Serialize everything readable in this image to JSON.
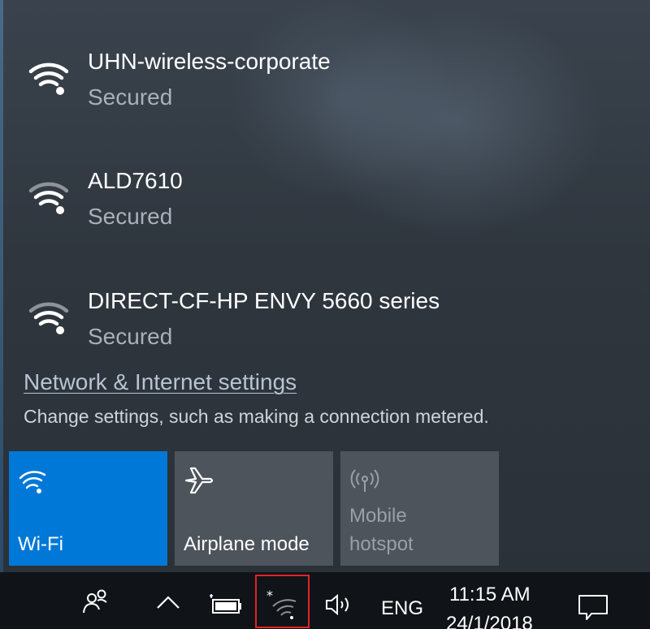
{
  "networks": [
    {
      "name": "UHN-wireless-corporate",
      "status": "Secured"
    },
    {
      "name": "ALD7610",
      "status": "Secured"
    },
    {
      "name": "DIRECT-CF-HP ENVY 5660 series",
      "status": "Secured"
    }
  ],
  "settings": {
    "link": "Network & Internet settings",
    "description": "Change settings, such as making a connection metered."
  },
  "tiles": {
    "wifi": {
      "label": "Wi-Fi",
      "state": "on",
      "icon": "wifi-icon"
    },
    "airplane": {
      "label": "Airplane mode",
      "state": "off",
      "icon": "airplane-icon"
    },
    "hotspot": {
      "label_line1": "Mobile",
      "label_line2": "hotspot",
      "state": "disabled",
      "icon": "hotspot-icon"
    }
  },
  "taskbar": {
    "language": "ENG",
    "time": "11:15 AM",
    "date": "24/1/2018",
    "icons": [
      "people-icon",
      "chevron-up-icon",
      "battery-icon",
      "wifi-tray-icon",
      "volume-icon",
      "action-center-icon"
    ]
  },
  "colors": {
    "accent": "#0078d7",
    "tile_inactive": "#4d545b",
    "taskbar": "#101418",
    "highlight": "#e0242a"
  }
}
